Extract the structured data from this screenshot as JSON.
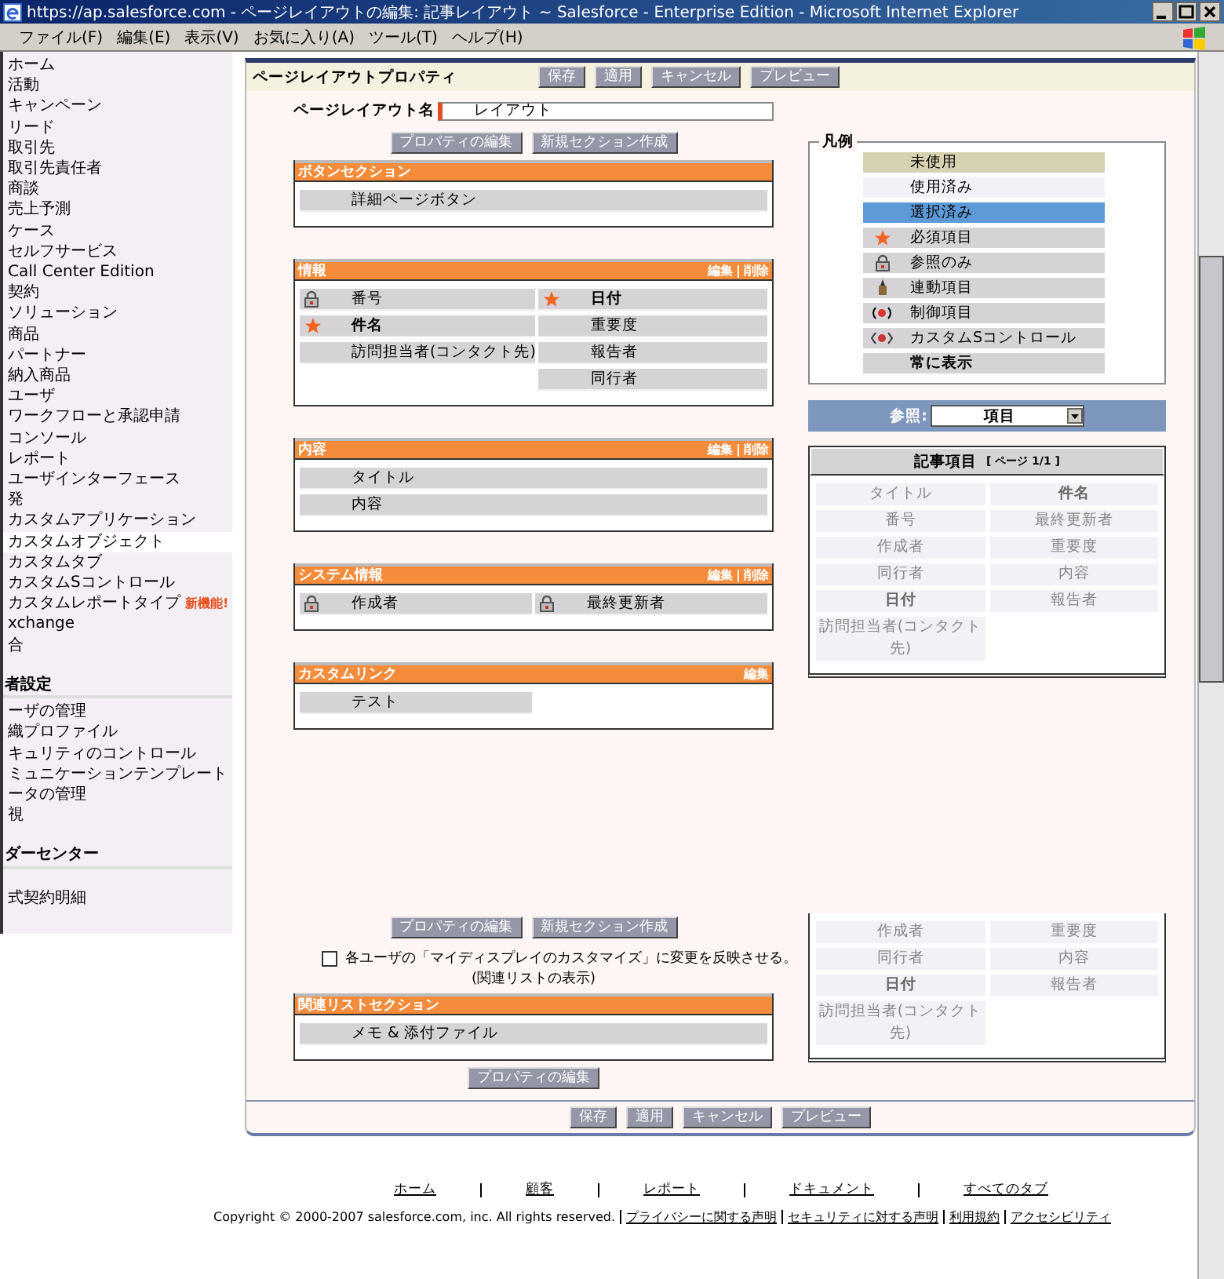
{
  "window": {
    "title": "https://ap.salesforce.com - ページレイアウトの編集: 記事レイアウト ~ Salesforce - Enterprise Edition - Microsoft Internet Explorer"
  },
  "menu": [
    "ファイル(F)",
    "編集(E)",
    "表示(V)",
    "お気に入り(A)",
    "ツール(T)",
    "ヘルプ(H)"
  ],
  "sidebar": {
    "groups": [
      {
        "items": [
          {
            "label": "ホーム",
            "selected": false
          },
          {
            "label": "活動",
            "selected": false
          },
          {
            "label": "キャンペーン",
            "selected": false
          },
          {
            "label": "リード",
            "selected": false
          },
          {
            "label": "取引先",
            "selected": false
          },
          {
            "label": "取引先責任者",
            "selected": false
          },
          {
            "label": "商談",
            "selected": false
          },
          {
            "label": "売上予測",
            "selected": false
          },
          {
            "label": "ケース",
            "selected": false
          },
          {
            "label": "セルフサービス",
            "selected": false
          },
          {
            "label": "Call Center Edition",
            "selected": false
          },
          {
            "label": "契約",
            "selected": false
          },
          {
            "label": "ソリューション",
            "selected": false
          },
          {
            "label": "商品",
            "selected": false
          },
          {
            "label": "パートナー",
            "selected": false
          },
          {
            "label": "納入商品",
            "selected": false
          },
          {
            "label": "ユーザ",
            "selected": false
          },
          {
            "label": "ワークフローと承認申請",
            "selected": false
          },
          {
            "label": "コンソール",
            "selected": false
          },
          {
            "label": "レポート",
            "selected": false
          },
          {
            "label": "ユーザインターフェース",
            "selected": false
          },
          {
            "label": "発",
            "selected": false
          },
          {
            "label": "カスタムアプリケーション",
            "selected": false
          },
          {
            "label": "カスタムオブジェクト",
            "selected": true
          },
          {
            "label": "カスタムタブ",
            "selected": false
          },
          {
            "label": "カスタムSコントロール",
            "selected": false
          },
          {
            "label": "カスタムレポートタイプ",
            "selected": false,
            "badge": "新機能!"
          },
          {
            "label": "xchange",
            "selected": false
          },
          {
            "label": "合",
            "selected": false
          }
        ]
      },
      {
        "heading": "者設定",
        "items": [
          {
            "label": "ーザの管理",
            "selected": false
          },
          {
            "label": "織プロファイル",
            "selected": false
          },
          {
            "label": "キュリティのコントロール",
            "selected": false
          },
          {
            "label": "ミュニケーションテンプレート",
            "selected": false
          },
          {
            "label": "ータの管理",
            "selected": false
          },
          {
            "label": "視",
            "selected": false
          }
        ]
      },
      {
        "heading": "ダーセンター"
      },
      {
        "items": [
          {
            "label": "式契約明細",
            "selected": false
          }
        ]
      }
    ]
  },
  "panel": {
    "title": "ページレイアウトプロパティ",
    "buttons": [
      "保存",
      "適用",
      "キャンセル",
      "プレビュー"
    ],
    "layout_name": {
      "label": "ページレイアウト名",
      "value": "レイアウト"
    },
    "top_buttons": [
      "プロパティの編集",
      "新規セクション作成"
    ],
    "sections": [
      {
        "title": "ボタンセクション",
        "columns": [
          [
            {
              "label": "詳細ページボタン",
              "kind": "plain"
            }
          ]
        ]
      },
      {
        "title": "情報",
        "actions": [
          "編集",
          "削除"
        ],
        "columns": [
          [
            {
              "label": "番号",
              "kind": "readonly"
            },
            {
              "label": "件名",
              "kind": "required"
            },
            {
              "label": "訪問担当者(コンタクト先)",
              "kind": "plain"
            }
          ],
          [
            {
              "label": "日付",
              "kind": "required"
            },
            {
              "label": "重要度",
              "kind": "plain"
            },
            {
              "label": "報告者",
              "kind": "plain"
            },
            {
              "label": "同行者",
              "kind": "plain"
            }
          ]
        ]
      },
      {
        "title": "内容",
        "actions": [
          "編集",
          "削除"
        ],
        "columns": [
          [
            {
              "label": "タイトル",
              "kind": "plain"
            },
            {
              "label": "内容",
              "kind": "plain"
            }
          ]
        ]
      },
      {
        "title": "システム情報",
        "actions": [
          "編集",
          "削除"
        ],
        "columns": [
          [
            {
              "label": "作成者",
              "kind": "readonly"
            }
          ],
          [
            {
              "label": "最終更新者",
              "kind": "readonly"
            }
          ]
        ]
      },
      {
        "title": "カスタムリンク",
        "actions": [
          "編集"
        ],
        "columns": [
          [
            {
              "label": "テスト",
              "kind": "plain"
            }
          ],
          []
        ]
      }
    ],
    "mid_buttons": [
      "プロパティの編集",
      "新規セクション作成"
    ],
    "sync": {
      "checked": false,
      "label": "各ユーザの「マイディスプレイのカスタマイズ」に変更を反映させる。",
      "note": "(関連リストの表示)"
    },
    "related": {
      "title": "関連リストセクション",
      "columns": [
        [
          {
            "label": "メモ & 添付ファイル",
            "kind": "plain"
          }
        ]
      ]
    },
    "related_button": "プロパティの編集",
    "bottom_buttons": [
      "保存",
      "適用",
      "キャンセル",
      "プレビュー"
    ],
    "legend": {
      "title": "凡例",
      "items": [
        {
          "kind": "unused",
          "label": "未使用"
        },
        {
          "kind": "used",
          "label": "使用済み"
        },
        {
          "kind": "selected",
          "label": "選択済み"
        },
        {
          "kind": "required",
          "label": "必須項目"
        },
        {
          "kind": "readonly",
          "label": "参照のみ"
        },
        {
          "kind": "dependent",
          "label": "連動項目"
        },
        {
          "kind": "controlling",
          "label": "制御項目"
        },
        {
          "kind": "scontrol",
          "label": "カスタムSコントロール"
        },
        {
          "kind": "always",
          "label": "常に表示"
        }
      ]
    },
    "browse": {
      "label": "参照:",
      "value": "項目"
    },
    "palette": {
      "title": "記事項目",
      "page": "[ ページ 1/1 ]",
      "items": [
        {
          "label": "タイトル",
          "required": false
        },
        {
          "label": "件名",
          "required": true
        },
        {
          "label": "番号",
          "required": false
        },
        {
          "label": "最終更新者",
          "required": false
        },
        {
          "label": "作成者",
          "required": false
        },
        {
          "label": "重要度",
          "required": false
        },
        {
          "label": "同行者",
          "required": false
        },
        {
          "label": "内容",
          "required": false
        },
        {
          "label": "日付",
          "required": true
        },
        {
          "label": "報告者",
          "required": false
        },
        {
          "label": "訪問担当者(コンタクト先)",
          "required": false
        }
      ]
    },
    "palette_repeat": {
      "items": [
        {
          "label": "作成者",
          "required": false
        },
        {
          "label": "重要度",
          "required": false
        },
        {
          "label": "同行者",
          "required": false
        },
        {
          "label": "内容",
          "required": false
        },
        {
          "label": "日付",
          "required": true
        },
        {
          "label": "報告者",
          "required": false
        },
        {
          "label": "訪問担当者(コンタクト先)",
          "required": false
        }
      ]
    }
  },
  "footer": {
    "links": [
      "ホーム",
      "顧客",
      "レポート",
      "ドキュメント",
      "すべてのタブ"
    ],
    "copyright": "Copyright © 2000-2007 salesforce.com, inc. All rights reserved.",
    "legal_links": [
      "プライバシーに関する声明",
      "セキュリティに対する声明",
      "利用規約",
      "アクセシビリティ"
    ]
  }
}
